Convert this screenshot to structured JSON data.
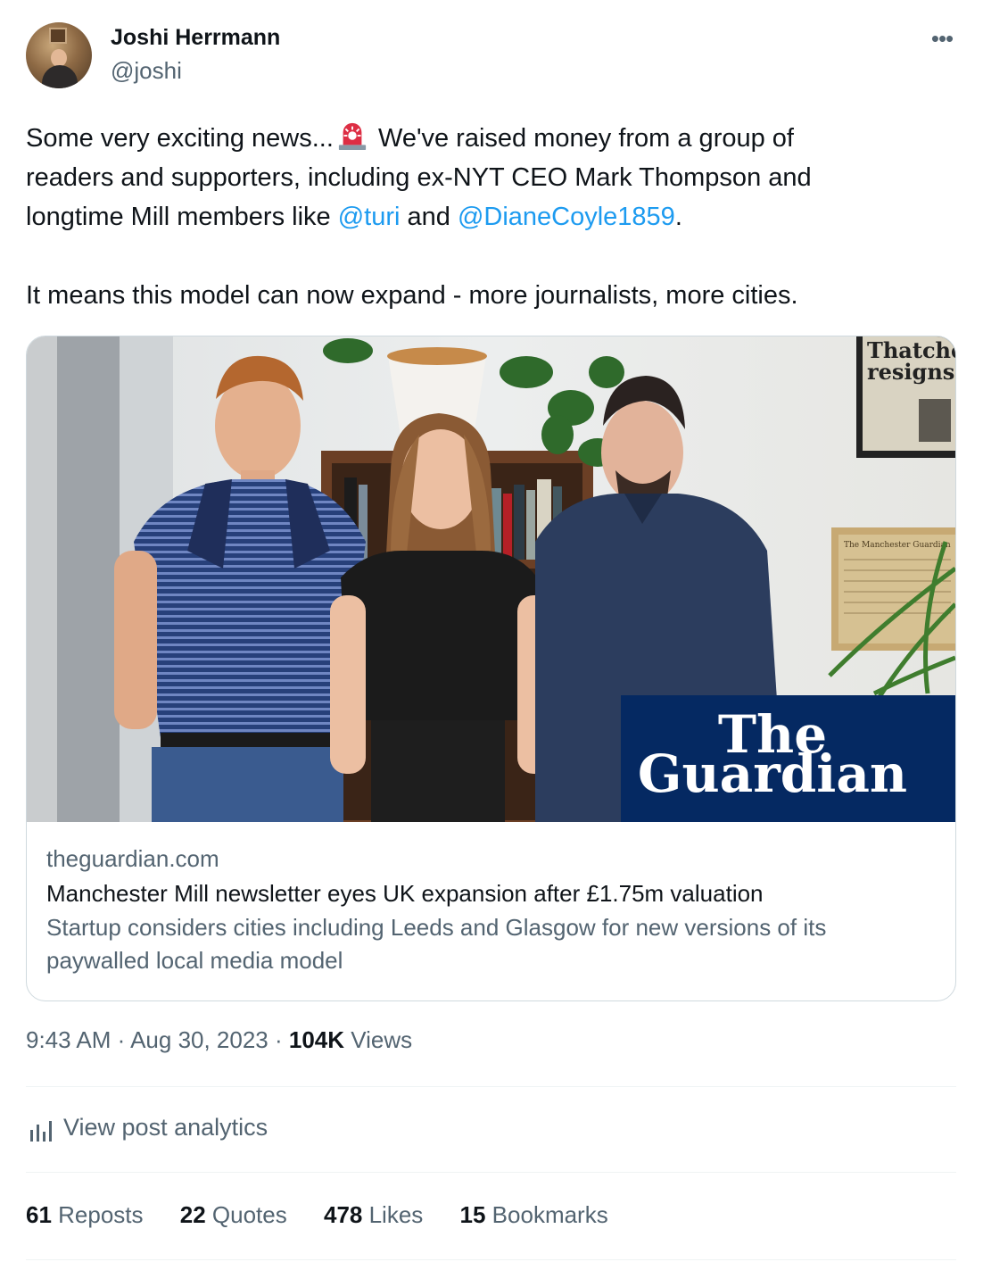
{
  "author": {
    "name": "Joshi Herrmann",
    "handle": "@joshi",
    "more_glyph": "•••"
  },
  "post": {
    "line1_pre": "Some very exciting news...",
    "line1_post": " We've raised money from a group of",
    "line2": "readers and supporters, including ex-NYT CEO Mark Thompson and",
    "line3_pre": "longtime Mill members like ",
    "mention1": "@turi",
    "line3_mid": " and ",
    "mention2": "@DianeCoyle1859",
    "line3_end": ".",
    "paragraph2": "It means this model can now expand - more journalists, more cities.",
    "emoji": "police-light-emoji"
  },
  "link_card": {
    "image": {
      "logo_line1": "The",
      "logo_line2": "Guardian",
      "newspaper_headline_1": "Thatcher",
      "newspaper_headline_2": "resigns",
      "masthead": "The Manchester Guardian"
    },
    "domain": "theguardian.com",
    "title": "Manchester Mill newsletter eyes UK expansion after £1.75m valuation",
    "description_line1": "Startup considers cities including Leeds and Glasgow for new versions of its",
    "description_line2": "paywalled local media model"
  },
  "meta": {
    "time": "9:43 AM",
    "sep1": " · ",
    "date": "Aug 30, 2023",
    "sep2": " · ",
    "views_count": "104K",
    "views_label": " Views"
  },
  "analytics": {
    "label": "View post analytics",
    "icon": "analytics-bar-icon"
  },
  "stats": [
    {
      "count": "61",
      "label": " Reposts"
    },
    {
      "count": "22",
      "label": " Quotes"
    },
    {
      "count": "478",
      "label": " Likes"
    },
    {
      "count": "15",
      "label": " Bookmarks"
    }
  ],
  "colors": {
    "link": "#1d9bf0",
    "secondary": "#536471",
    "guardian_blue": "#052962"
  }
}
